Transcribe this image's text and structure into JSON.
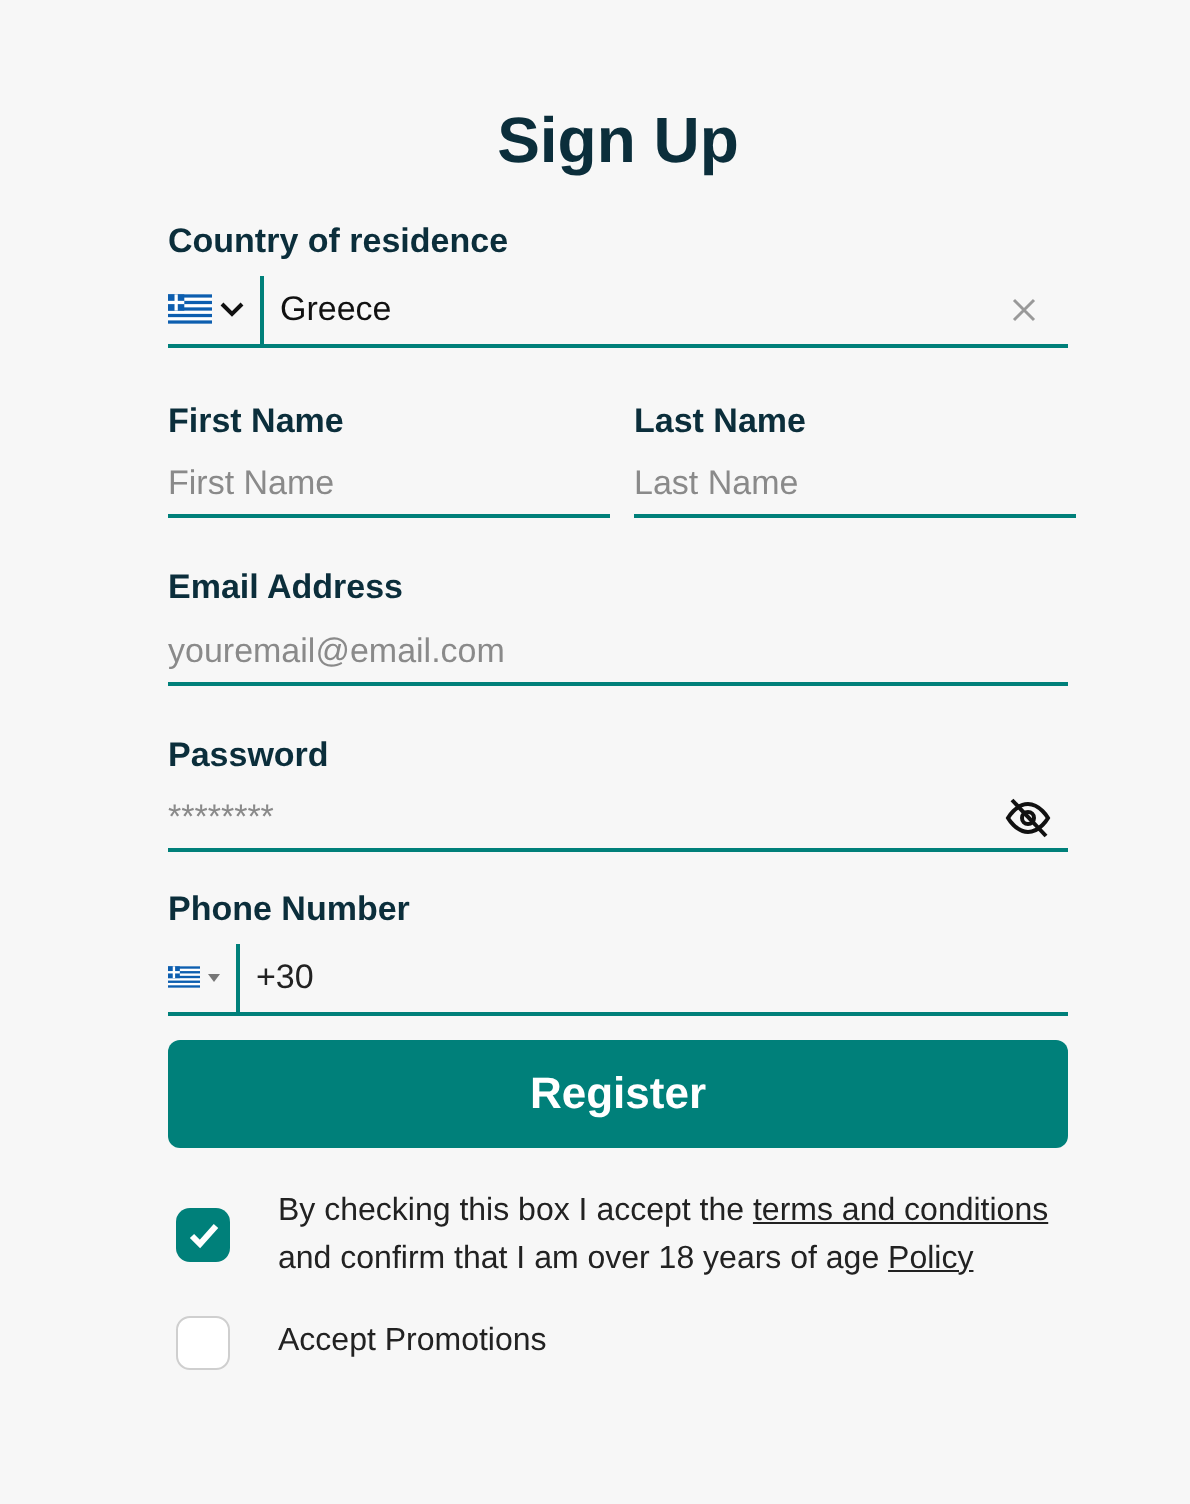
{
  "title": "Sign Up",
  "country": {
    "label": "Country of residence",
    "value": "Greece"
  },
  "first_name": {
    "label": "First Name",
    "placeholder": "First Name"
  },
  "last_name": {
    "label": "Last Name",
    "placeholder": "Last Name"
  },
  "email": {
    "label": "Email Address",
    "placeholder": "youremail@email.com"
  },
  "password": {
    "label": "Password",
    "placeholder": "********"
  },
  "phone": {
    "label": "Phone Number",
    "value": "+30"
  },
  "register": "Register",
  "consents": [
    {
      "checked": true,
      "parts": [
        {
          "kind": "text",
          "text": "By checking this box I accept the "
        },
        {
          "kind": "link",
          "text": "terms and conditions"
        },
        {
          "kind": "text",
          "text": " and confirm that I am over 18 years of age "
        },
        {
          "kind": "link",
          "text": "Policy"
        }
      ]
    },
    {
      "checked": false,
      "parts": [
        {
          "kind": "text",
          "text": "Accept Promotions"
        }
      ]
    }
  ]
}
